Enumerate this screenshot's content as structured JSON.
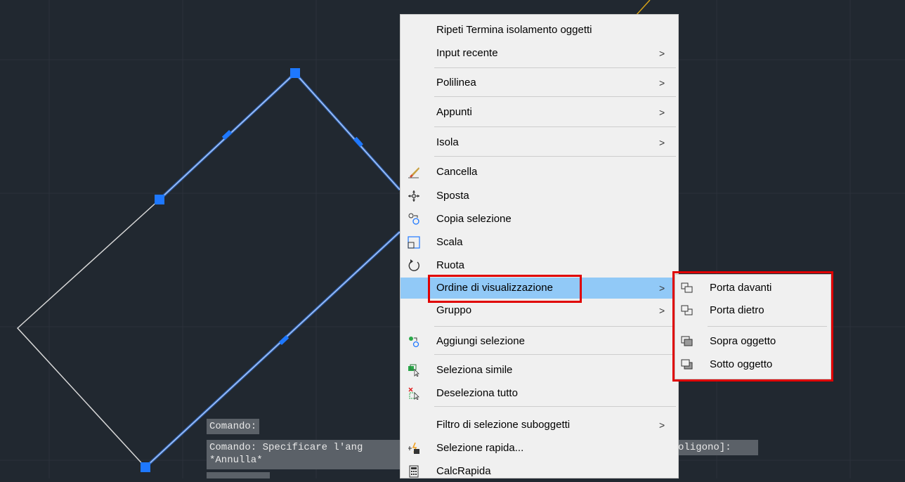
{
  "context_menu": {
    "items": [
      {
        "label": "Ripeti Termina isolamento oggetti",
        "submenu": false,
        "icon": ""
      },
      {
        "label": "Input recente",
        "submenu": true,
        "icon": ""
      },
      {
        "label": "Polilinea",
        "submenu": true,
        "icon": ""
      },
      {
        "label": "Appunti",
        "submenu": true,
        "icon": ""
      },
      {
        "label": "Isola",
        "submenu": true,
        "icon": ""
      },
      {
        "label": "Cancella",
        "submenu": false,
        "icon": "eraser-icon"
      },
      {
        "label": "Sposta",
        "submenu": false,
        "icon": "move-icon"
      },
      {
        "label": "Copia selezione",
        "submenu": false,
        "icon": "copy-icon"
      },
      {
        "label": "Scala",
        "submenu": false,
        "icon": "scale-icon"
      },
      {
        "label": "Ruota",
        "submenu": false,
        "icon": "rotate-icon"
      },
      {
        "label": "Ordine di visualizzazione",
        "submenu": true,
        "icon": "",
        "highlighted": true
      },
      {
        "label": "Gruppo",
        "submenu": true,
        "icon": ""
      },
      {
        "label": "Aggiungi selezione",
        "submenu": false,
        "icon": "add-selected-icon"
      },
      {
        "label": "Seleziona simile",
        "submenu": false,
        "icon": "select-similar-icon"
      },
      {
        "label": "Deseleziona tutto",
        "submenu": false,
        "icon": "deselect-all-icon"
      },
      {
        "label": "Filtro di selezione suboggetti",
        "submenu": true,
        "icon": ""
      },
      {
        "label": "Selezione rapida...",
        "submenu": false,
        "icon": "quick-select-icon"
      },
      {
        "label": "CalcRapida",
        "submenu": false,
        "icon": "calculator-icon"
      }
    ],
    "arrow": ">"
  },
  "submenu": {
    "items": [
      {
        "label": "Porta davanti",
        "icon": "bring-to-front-icon"
      },
      {
        "label": "Porta dietro",
        "icon": "send-to-back-icon"
      },
      {
        "label": "Sopra oggetto",
        "icon": "bring-above-icon"
      },
      {
        "label": "Sotto oggetto",
        "icon": "send-under-icon"
      }
    ]
  },
  "command_line": {
    "line1": "Comando:",
    "line2a": "Comando: Specificare l'ang",
    "line2b": "oligono]:",
    "line3": "*Annulla*"
  },
  "colors": {
    "canvas_bg": "#212830",
    "selection": "#4a8cf0",
    "grip": "#1e78ff",
    "highlight": "#91c9f7",
    "callout": "#e00000"
  }
}
